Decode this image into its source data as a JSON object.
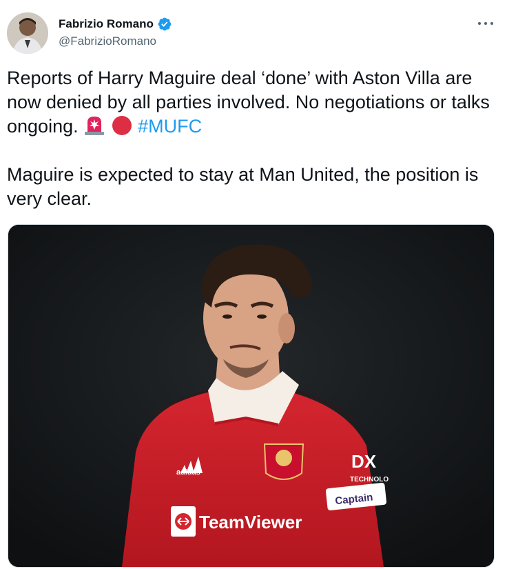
{
  "author": {
    "name": "Fabrizio Romano",
    "handle": "@FabrizioRomano",
    "verified": true,
    "avatar_icon": "profile-photo"
  },
  "tweet": {
    "line1": "Reports of Harry Maguire deal ‘done’ with Aston Villa are now denied by all parties involved. No negotiations or talks ongoing.",
    "emoji1": "siren-emoji",
    "emoji2": "red-circle-emoji",
    "hashtag": "#MUFC",
    "paragraph2": "Maguire is expected to stay at Man United, the position is very clear."
  },
  "media": {
    "icon": "photo-football-player",
    "shirt_texts": {
      "sponsor": "TeamViewer",
      "brand": "adidas",
      "armband": "Captain",
      "sleeve": "DX",
      "sleeve_sub": "TECHNOLO"
    }
  },
  "colors": {
    "hashtag": "#1d9bf0",
    "verified": "#1d9bf0",
    "shirt": "#d4202c"
  }
}
